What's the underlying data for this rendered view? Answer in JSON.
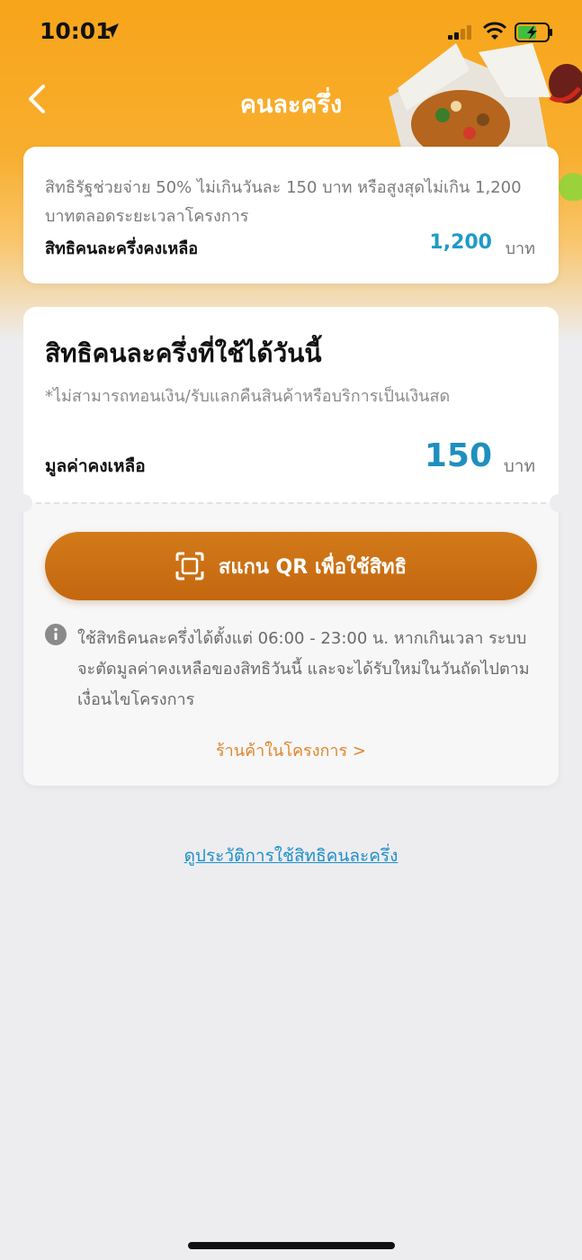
{
  "status": {
    "time": "10:01"
  },
  "header": {
    "title": "คนละครึ่ง"
  },
  "summary": {
    "description": "สิทธิรัฐช่วยจ่าย 50% ไม่เกินวันละ 150 บาท หรือสูงสุดไม่เกิน 1,200 บาทตลอดระยะเวลาโครงการ",
    "remaining_label": "สิทธิคนละครึ่งคงเหลือ",
    "remaining_value": "1,200",
    "remaining_unit": "บาท"
  },
  "today": {
    "title": "สิทธิคนละครึ่งที่ใช้ได้วันนี้",
    "note": "*ไม่สามารถทอนเงิน/รับแลกคืนสินค้าหรือบริการเป็นเงินสด",
    "balance_label": "มูลค่าคงเหลือ",
    "balance_value": "150",
    "balance_unit": "บาท",
    "scan_label": "สแกน QR เพื่อใช้สิทธิ",
    "info_text": "ใช้สิทธิคนละครึ่งได้ตั้งแต่ 06:00 - 23:00 น. หากเกินเวลา ระบบจะตัดมูลค่าคงเหลือของสิทธิวันนี้ และจะได้รับใหม่ในวันถัดไปตามเงื่อนไขโครงการ",
    "shop_link": "ร้านค้าในโครงการ >"
  },
  "history_link": "ดูประวัติการใช้สิทธิคนละครึ่ง",
  "colors": {
    "header_orange": "#f7a51a",
    "button_orange": "#c4670f",
    "accent_blue": "#1f8fbf",
    "link_orange": "#e0862c"
  },
  "icons": [
    "location-arrow-icon",
    "signal-icon",
    "wifi-icon",
    "battery-charging-icon",
    "back-chevron-icon",
    "qr-scan-icon",
    "info-icon"
  ]
}
